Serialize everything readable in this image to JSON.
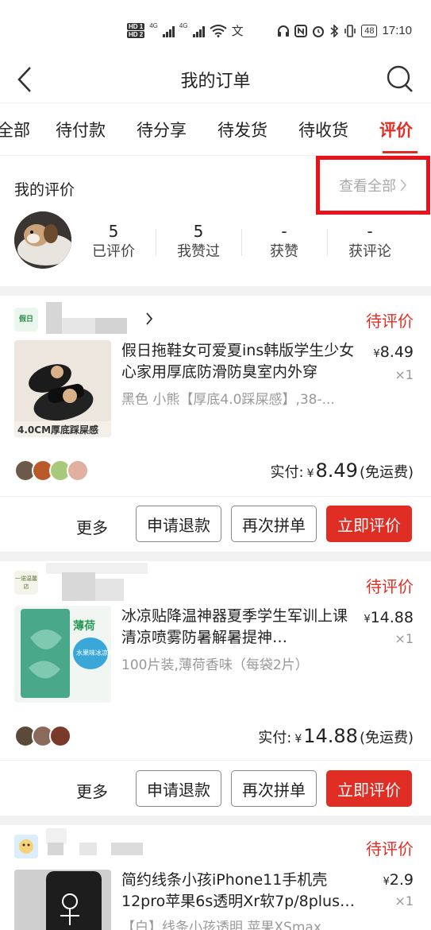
{
  "status_bar": {
    "hd1": "HD 1",
    "hd2": "HD 2",
    "net1": "4G",
    "net2": "4G",
    "battery": "48",
    "time": "17:10"
  },
  "nav": {
    "title": "我的订单"
  },
  "tabs": [
    {
      "label": "全部"
    },
    {
      "label": "待付款"
    },
    {
      "label": "待分享"
    },
    {
      "label": "待发货"
    },
    {
      "label": "待收货"
    },
    {
      "label": "评价",
      "active": true
    }
  ],
  "review_section": {
    "title": "我的评价",
    "view_all": "查看全部",
    "stats": [
      {
        "num": "5",
        "label": "已评价"
      },
      {
        "num": "5",
        "label": "我赞过"
      },
      {
        "num": "-",
        "label": "获赞"
      },
      {
        "num": "-",
        "label": "获评论"
      }
    ]
  },
  "orders": [
    {
      "shop_icon_text": "假日",
      "status": "待评价",
      "product_name": "假日拖鞋女可爱夏ins韩版学生少女心家用厚底防滑防臭室内外穿",
      "spec": "黑色 小熊【厚底4.0踩屎感】,38-...",
      "thumb_caption": "4.0CM厚底踩屎感",
      "currency": "¥",
      "price": "8.49",
      "qty": "×1",
      "paid_label": "实付:",
      "paid_amount": "8.49",
      "shipping": "(免运费)",
      "more": "更多",
      "btn_refund": "申请退款",
      "btn_reorder": "再次拼单",
      "btn_review": "立即评价"
    },
    {
      "shop_icon_text": "一诺温馨店",
      "status": "待评价",
      "product_name": "冰凉贴降温神器夏季学生军训上课清凉喷雾防暑解暑提神…",
      "spec": "100片装,薄荷香味（每袋2片）",
      "thumb_caption": "薄荷",
      "thumb_sub": "水果味冰凉贴",
      "currency": "¥",
      "price": "14.88",
      "qty": "×1",
      "paid_label": "实付:",
      "paid_amount": "14.88",
      "shipping": "(免运费)",
      "more": "更多",
      "btn_refund": "申请退款",
      "btn_reorder": "再次拼单",
      "btn_review": "立即评价"
    },
    {
      "status": "待评价",
      "product_name": "简约线条小孩iPhone11手机壳12pro苹果6s透明Xr软7p/8plus…",
      "spec": "【白】线条小孩透明,苹果XSmax",
      "currency": "¥",
      "price": "2.9",
      "qty": "×1"
    }
  ]
}
